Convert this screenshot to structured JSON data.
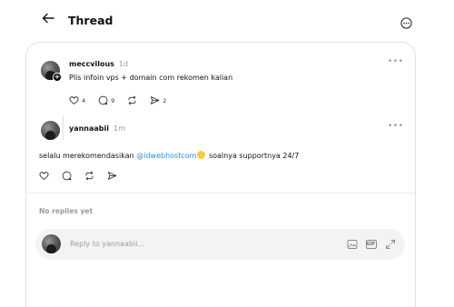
{
  "header": {
    "title": "Thread"
  },
  "original_post": {
    "username": "meccvilous",
    "time": "1d",
    "content": "Plis infoin vps + domain com rekomen kalian",
    "likes": "4",
    "comments": "9",
    "shares": "2"
  },
  "reply": {
    "username": "yannaabii",
    "time": "1m",
    "text_before": "selalu merekomendasikan ",
    "mention": "@idwebhostcom",
    "text_after": " soalnya supportnya 24/7"
  },
  "no_replies_label": "No replies yet",
  "reply_box": {
    "placeholder": "Reply to yannaabii...",
    "gif_label": "GIF"
  },
  "icons": [
    "back-arrow-icon",
    "more-circle-icon",
    "plus-badge-icon",
    "ellipsis-icon",
    "heart-icon",
    "comment-icon",
    "repost-icon",
    "share-icon",
    "image-icon",
    "gif-icon",
    "expand-icon"
  ]
}
